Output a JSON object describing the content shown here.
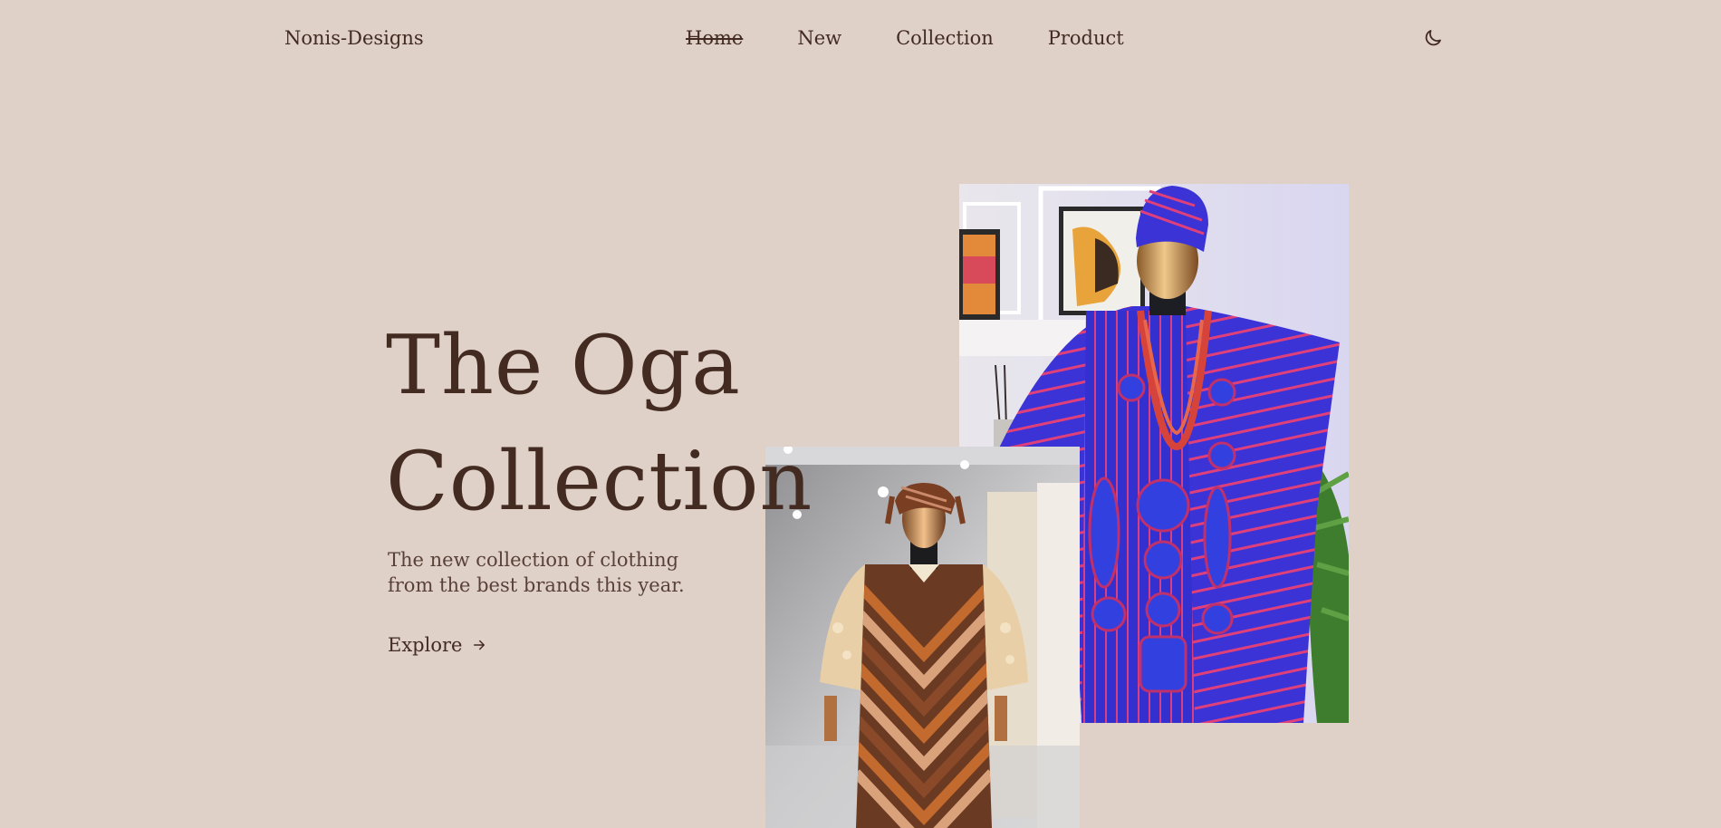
{
  "brand": {
    "name": "Nonis-Designs"
  },
  "nav": {
    "items": [
      {
        "label": "Home",
        "active": true
      },
      {
        "label": "New",
        "active": false
      },
      {
        "label": "Collection",
        "active": false
      },
      {
        "label": "Product",
        "active": false
      }
    ],
    "theme_icon": "moon-icon"
  },
  "hero": {
    "title_line1": "The Oga",
    "title_line2": "Collection",
    "description": "The new collection of clothing from the best brands this year.",
    "cta_label": "Explore",
    "cta_icon": "arrow-right-icon"
  },
  "images": {
    "primary": "blue-agbada-outfit-photo",
    "secondary": "brown-chevron-robe-outfit-photo"
  },
  "colors": {
    "background": "#dfd1c8",
    "text": "#432b21",
    "agbada_blue": "#3b33d6",
    "agbada_stripe": "#e0407a",
    "robe_brown": "#6b3a22",
    "robe_orange": "#c36a2e"
  }
}
